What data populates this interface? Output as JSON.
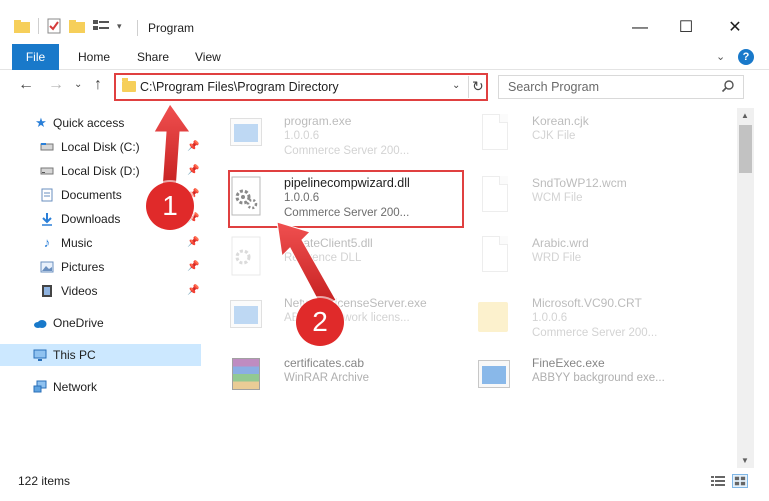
{
  "window": {
    "title": "Program",
    "controls": {
      "minimize": "—",
      "maximize": "☐",
      "close": "✕"
    }
  },
  "ribbon": {
    "tabs": [
      "File",
      "Home",
      "Share",
      "View"
    ],
    "expand": "⌄",
    "help": "?"
  },
  "nav": {
    "back": "←",
    "forward": "→",
    "recent": "⌄",
    "up": "↑",
    "address": "C:\\Program Files\\Program Directory",
    "address_dropdown": "⌄",
    "refresh": "↻",
    "search_placeholder": "Search Program"
  },
  "sidebar": {
    "items": [
      {
        "label": "Quick access",
        "icon": "star-icon",
        "pinned": false
      },
      {
        "label": "Local Disk (C:)",
        "icon": "drive-icon",
        "pinned": true
      },
      {
        "label": "Local Disk (D:)",
        "icon": "drive-icon",
        "pinned": true
      },
      {
        "label": "Documents",
        "icon": "documents-icon",
        "pinned": true
      },
      {
        "label": "Downloads",
        "icon": "downloads-icon",
        "pinned": true
      },
      {
        "label": "Music",
        "icon": "music-icon",
        "pinned": true
      },
      {
        "label": "Pictures",
        "icon": "pictures-icon",
        "pinned": true
      },
      {
        "label": "Videos",
        "icon": "videos-icon",
        "pinned": true
      },
      {
        "label": "OneDrive",
        "icon": "cloud-icon",
        "pinned": false
      },
      {
        "label": "This PC",
        "icon": "computer-icon",
        "pinned": false,
        "selected": true
      },
      {
        "label": "Network",
        "icon": "network-icon",
        "pinned": false
      }
    ],
    "pin_glyph": "📌"
  },
  "files": [
    {
      "name": "program.exe",
      "line1": "1.0.0.6",
      "line2": "Commerce Server 200...",
      "icon": "program-exe-icon",
      "faded": true
    },
    {
      "name": "Korean.cjk",
      "line1": "CJK File",
      "line2": "",
      "icon": "document-icon",
      "faded": true
    },
    {
      "name": "pipelinecompwizard.dll",
      "line1": "1.0.0.6",
      "line2": "Commerce Server 200...",
      "icon": "dll-gear-icon",
      "faded": false,
      "highlighted": true
    },
    {
      "name": "SndToWP12.wcm",
      "line1": "WCM File",
      "line2": "",
      "icon": "document-icon",
      "faded": true
    },
    {
      "name": "CreateClient5.dll",
      "line1": "Reference DLL",
      "line2": "",
      "icon": "dll-gear-icon",
      "faded": true
    },
    {
      "name": "Arabic.wrd",
      "line1": "WRD File",
      "line2": "",
      "icon": "document-icon",
      "faded": true
    },
    {
      "name": "NetworkLicenseServer.exe",
      "line1": "ABBYY Network licens...",
      "line2": "",
      "icon": "exe-window-icon",
      "faded": true
    },
    {
      "name": "Microsoft.VC90.CRT",
      "line1": "1.0.0.6",
      "line2": "Commerce Server 200...",
      "icon": "folder-icon",
      "faded": true
    },
    {
      "name": "certificates.cab",
      "line1": "WinRAR Archive",
      "line2": "",
      "icon": "winrar-icon",
      "faded": true
    },
    {
      "name": "FineExec.exe",
      "line1": "ABBYY background exe...",
      "line2": "",
      "icon": "exe-window-icon",
      "faded": true
    }
  ],
  "status": {
    "count": "122 items"
  },
  "callouts": {
    "one": "1",
    "two": "2"
  },
  "colors": {
    "accent": "#1979ca",
    "highlight": "#e04040",
    "callout": "#e02a2a",
    "selected": "#cce8ff"
  }
}
